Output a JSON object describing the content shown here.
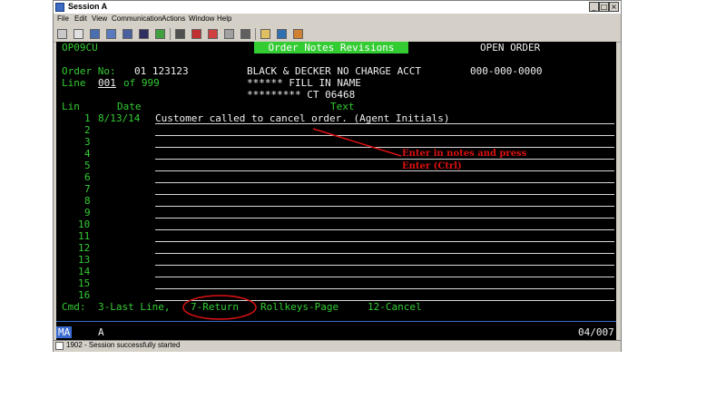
{
  "window": {
    "title": "Session A"
  },
  "menu": [
    "File",
    "Edit",
    "View",
    "Communication",
    "Actions",
    "Window",
    "Help"
  ],
  "screen": {
    "program_id": "OP09CU",
    "header_title": "Order Notes Revisions",
    "mode": "OPEN ORDER",
    "order_label": "Order No:",
    "order_no": "01 123123",
    "customer_name": "BLACK & DECKER NO CHARGE ACCT",
    "phone": "000-000-0000",
    "line_label": "Line",
    "line_value": "001",
    "line_of": "of 999",
    "fill_name": "****** FILL IN NAME",
    "address": "********* CT 06468",
    "col_lin": "Lin",
    "col_date": "Date",
    "col_text": "Text",
    "rows": [
      {
        "num": "1",
        "date": "8/13/14",
        "text": "Customer called to cancel order. (Agent Initials)"
      },
      {
        "num": "2",
        "date": "",
        "text": ""
      },
      {
        "num": "3",
        "date": "",
        "text": ""
      },
      {
        "num": "4",
        "date": "",
        "text": ""
      },
      {
        "num": "5",
        "date": "",
        "text": ""
      },
      {
        "num": "6",
        "date": "",
        "text": ""
      },
      {
        "num": "7",
        "date": "",
        "text": ""
      },
      {
        "num": "8",
        "date": "",
        "text": ""
      },
      {
        "num": "9",
        "date": "",
        "text": ""
      },
      {
        "num": "10",
        "date": "",
        "text": ""
      },
      {
        "num": "11",
        "date": "",
        "text": ""
      },
      {
        "num": "12",
        "date": "",
        "text": ""
      },
      {
        "num": "13",
        "date": "",
        "text": ""
      },
      {
        "num": "14",
        "date": "",
        "text": ""
      },
      {
        "num": "15",
        "date": "",
        "text": ""
      },
      {
        "num": "16",
        "date": "",
        "text": ""
      }
    ],
    "cmd_label": "Cmd:",
    "cmd_last_line": "3-Last Line,",
    "cmd_return": "7-Return",
    "cmd_rollkeys": "Rollkeys-Page",
    "cmd_cancel": "12-Cancel",
    "oia_ma": "MA",
    "oia_a": "A",
    "oia_pos": "04/007"
  },
  "annotation": {
    "line1": "Enter in notes and press",
    "line2": "Enter (Ctrl)",
    "color": "#dd1111"
  },
  "status": {
    "text": "1902 - Session successfully started"
  }
}
